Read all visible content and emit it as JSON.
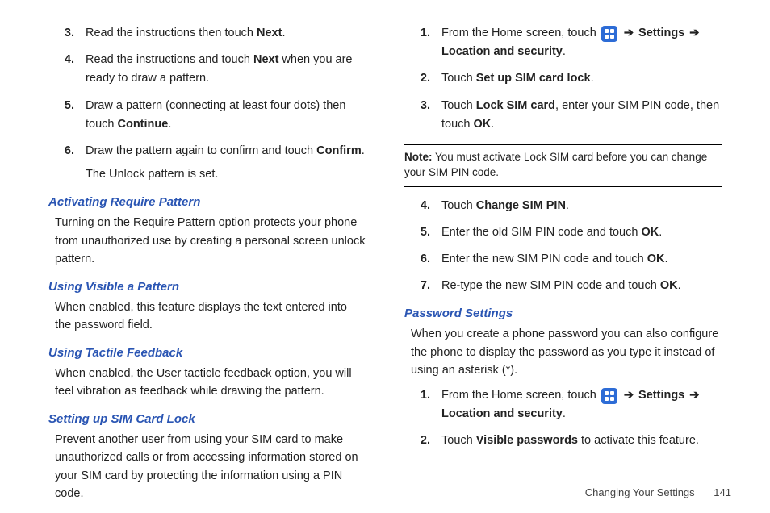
{
  "left": {
    "items_top": [
      {
        "n": "3.",
        "pre": "Read the instructions then touch ",
        "b": "Next",
        "post": "."
      },
      {
        "n": "4.",
        "pre": "Read the instructions and touch ",
        "b": "Next",
        "post": " when you are ready to draw a pattern."
      },
      {
        "n": "5.",
        "pre": "Draw a pattern (connecting at least four dots) then touch ",
        "b": "Continue",
        "post": "."
      },
      {
        "n": "6.",
        "pre": "Draw the pattern again to confirm and touch ",
        "b": "Confirm",
        "post": ".",
        "extra": "The Unlock pattern is set."
      }
    ],
    "h1": "Activating Require Pattern",
    "p1": "Turning on the Require Pattern option protects your phone from unauthorized use by creating a personal screen unlock pattern.",
    "h2": "Using Visible a Pattern",
    "p2": "When enabled, this feature displays the text entered into the password field.",
    "h3": "Using Tactile Feedback",
    "p3": "When enabled, the User tacticle feedback option, you will feel vibration as feedback while drawing the pattern.",
    "h4": "Setting up SIM Card Lock",
    "p4": "Prevent another user from using your SIM card to make unauthorized calls or from accessing information stored on your SIM card by protecting the information using a PIN code."
  },
  "right": {
    "step1": {
      "n": "1.",
      "pre": "From the Home screen, touch ",
      "arrow": "➔",
      "b1": "Settings",
      "arrow2": "➔",
      "b2": "Location and security",
      "post": "."
    },
    "step2": {
      "n": "2.",
      "pre": "Touch ",
      "b": "Set up SIM card lock",
      "post": "."
    },
    "step3": {
      "n": "3.",
      "pre": "Touch ",
      "b": "Lock SIM card",
      "mid": ", enter your SIM PIN code, then touch ",
      "b2": "OK",
      "post": "."
    },
    "note_label": "Note:",
    "note_body": " You must activate Lock SIM card before you can change your SIM PIN code.",
    "step4": {
      "n": "4.",
      "pre": "Touch ",
      "b": "Change SIM PIN",
      "post": "."
    },
    "step5": {
      "n": "5.",
      "pre": "Enter the old SIM PIN code and touch ",
      "b": "OK",
      "post": "."
    },
    "step6": {
      "n": "6.",
      "pre": "Enter the new SIM PIN code and touch ",
      "b": "OK",
      "post": "."
    },
    "step7": {
      "n": "7.",
      "pre": "Re-type the new SIM PIN code and touch ",
      "b": "OK",
      "post": "."
    },
    "h5": "Password Settings",
    "p5": "When you create a phone password you can also configure the phone to display the password as you type it instead of using an asterisk (*).",
    "pw1": {
      "n": "1.",
      "pre": "From the Home screen, touch ",
      "arrow": "➔",
      "b1": "Settings",
      "arrow2": "➔",
      "b2": "Location and security",
      "post": "."
    },
    "pw2": {
      "n": "2.",
      "pre": "Touch ",
      "b": "Visible passwords",
      "post": " to activate this feature."
    }
  },
  "footer": {
    "section": "Changing Your Settings",
    "page": "141"
  }
}
